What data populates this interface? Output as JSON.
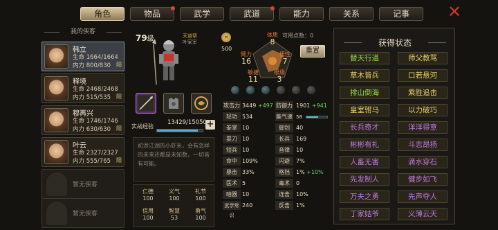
{
  "tabs": [
    {
      "label": "角色",
      "active": true,
      "dot": false
    },
    {
      "label": "物品",
      "active": false,
      "dot": true
    },
    {
      "label": "武学",
      "active": false,
      "dot": false
    },
    {
      "label": "武道",
      "active": false,
      "dot": true
    },
    {
      "label": "能力",
      "active": false,
      "dot": false
    },
    {
      "label": "关系",
      "active": false,
      "dot": false
    },
    {
      "label": "记事",
      "active": false,
      "dot": false
    }
  ],
  "close_icon": "close-x-icon",
  "sidebar": {
    "title": "我的侠客",
    "heroes": [
      {
        "name": "韩立",
        "hp": "生命 1664/1664",
        "mp": "内力 800/830",
        "flag": "阳",
        "selected": true
      },
      {
        "name": "释境",
        "hp": "生命 2468/2468",
        "mp": "内力 515/535",
        "flag": "阳",
        "selected": false
      },
      {
        "name": "穆再兴",
        "hp": "生命 1746/1746",
        "mp": "内力 630/630",
        "flag": "阳",
        "selected": false
      },
      {
        "name": "叶云",
        "hp": "生命 2327/2327",
        "mp": "内力 555/765",
        "flag": "阳",
        "selected": false
      }
    ],
    "empty_slots": [
      "暂无侠客",
      "暂无侠客"
    ]
  },
  "character": {
    "level": "79",
    "level_unit": "级",
    "sect": "天道帮",
    "title": "叶家军",
    "money": "500",
    "exp_label": "实战经验",
    "exp_value": "13429/15050",
    "exp_progress": 0.892,
    "bio": "初涉江湖的小虾米，会有怎样的未来还都是未知数，一切皆有可能。",
    "virtues": [
      {
        "label": "仁德",
        "value": "100"
      },
      {
        "label": "义气",
        "value": "100"
      },
      {
        "label": "礼节",
        "value": "100"
      },
      {
        "label": "信用",
        "value": "100"
      },
      {
        "label": "智慧",
        "value": "53"
      },
      {
        "label": "勇气",
        "value": "100"
      }
    ]
  },
  "attributes": {
    "points_label": "可用点数：0",
    "reset_label": "重置",
    "items": [
      {
        "label": "体质",
        "value": "8"
      },
      {
        "label": "臂力",
        "value": "16"
      },
      {
        "label": "悟性",
        "value": "7"
      },
      {
        "label": "敏捷",
        "value": "11"
      },
      {
        "label": "根缘",
        "value": "3"
      }
    ]
  },
  "stats": {
    "rows": [
      {
        "l1": "攻击力",
        "v1": "3449",
        "b1": "+497",
        "l2": "防御力",
        "v2": "1901",
        "b2": "+941"
      },
      {
        "l1": "轻功",
        "v1": "534",
        "b1": "",
        "l2": "集气速度",
        "v2": "58",
        "b2": ""
      },
      {
        "l1": "拳掌",
        "v1": "10",
        "b1": "",
        "l2": "御剑",
        "v2": "40",
        "b2": ""
      },
      {
        "l1": "耍刀",
        "v1": "10",
        "b1": "",
        "l2": "长兵",
        "v2": "169",
        "b2": ""
      },
      {
        "l1": "短兵",
        "v1": "10",
        "b1": "",
        "l2": "音律",
        "v2": "10",
        "b2": ""
      },
      {
        "l1": "命中",
        "v1": "109%",
        "b1": "",
        "l2": "闪避",
        "v2": "7%",
        "b2": ""
      },
      {
        "l1": "暴击",
        "v1": "33%",
        "b1": "",
        "l2": "格挡",
        "v2": "1%",
        "b2": "+10%"
      },
      {
        "l1": "医术",
        "v1": "5",
        "b1": "",
        "l2": "毒术",
        "v2": "0",
        "b2": ""
      },
      {
        "l1": "暗器",
        "v1": "10",
        "b1": "",
        "l2": "连击",
        "v2": "10%",
        "b2": ""
      },
      {
        "l1": "武学常识",
        "v1": "240",
        "b1": "",
        "l2": "反击",
        "v2": "1%",
        "b2": ""
      }
    ],
    "speed_progress": 0.58
  },
  "status_panel": {
    "title": "获得状态",
    "items": [
      {
        "label": "替天行道",
        "color": "#9ad848"
      },
      {
        "label": "师父教骂",
        "color": "#e8d06a"
      },
      {
        "label": "草木皆兵",
        "color": "#e8d06a"
      },
      {
        "label": "口若悬河",
        "color": "#e8d06a"
      },
      {
        "label": "排山倒海",
        "color": "#9ad848"
      },
      {
        "label": "乘胜追击",
        "color": "#e8d06a"
      },
      {
        "label": "皇室驸马",
        "color": "#e8d06a"
      },
      {
        "label": "以力破巧",
        "color": "#e8d06a"
      },
      {
        "label": "长兵奇才",
        "color": "#c07ae0"
      },
      {
        "label": "洋洋得意",
        "color": "#c07ae0"
      },
      {
        "label": "彬彬有礼",
        "color": "#c07ae0"
      },
      {
        "label": "斗志昂扬",
        "color": "#c07ae0"
      },
      {
        "label": "人畜无害",
        "color": "#c07ae0"
      },
      {
        "label": "滴水穿石",
        "color": "#c07ae0"
      },
      {
        "label": "先发制人",
        "color": "#c07ae0"
      },
      {
        "label": "健步如飞",
        "color": "#c07ae0"
      },
      {
        "label": "万夫之勇",
        "color": "#c07ae0"
      },
      {
        "label": "先声夺人",
        "color": "#c07ae0"
      },
      {
        "label": "丁家姑爷",
        "color": "#c07ae0"
      },
      {
        "label": "义薄云天",
        "color": "#c07ae0"
      }
    ]
  }
}
